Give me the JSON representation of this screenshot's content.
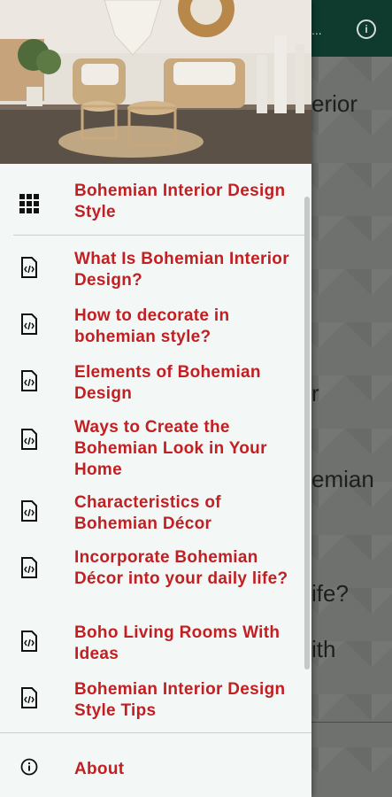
{
  "background": {
    "lines": [
      "erior",
      "r",
      "emian",
      "",
      "ife?",
      "ith"
    ]
  },
  "drawer": {
    "header_item": {
      "label": "Bohemian Interior Design Style",
      "icon": "grid-icon"
    },
    "items": [
      {
        "label": "What Is Bohemian Interior Design?",
        "icon": "code-file-icon"
      },
      {
        "label": "How to decorate in bohemian style?",
        "icon": "code-file-icon"
      },
      {
        "label": "Elements of Bohemian Design",
        "icon": "code-file-icon"
      },
      {
        "label": "Ways to Create the Bohemian Look in Your Home",
        "icon": "code-file-icon"
      },
      {
        "label": "Characteristics of Bohemian Décor",
        "icon": "code-file-icon"
      },
      {
        "label": "Incorporate Bohemian Décor into your daily life?",
        "icon": "code-file-icon"
      },
      {
        "label": "Boho Living Rooms With Ideas",
        "icon": "code-file-icon"
      },
      {
        "label": "Bohemian Interior Design Style Tips",
        "icon": "code-file-icon"
      }
    ],
    "about": {
      "label": "About",
      "icon": "info-icon"
    }
  },
  "colors": {
    "accent_red": "#c21f23",
    "appbar_green": "#0e3b2d",
    "drawer_bg": "#f3f7f6"
  }
}
